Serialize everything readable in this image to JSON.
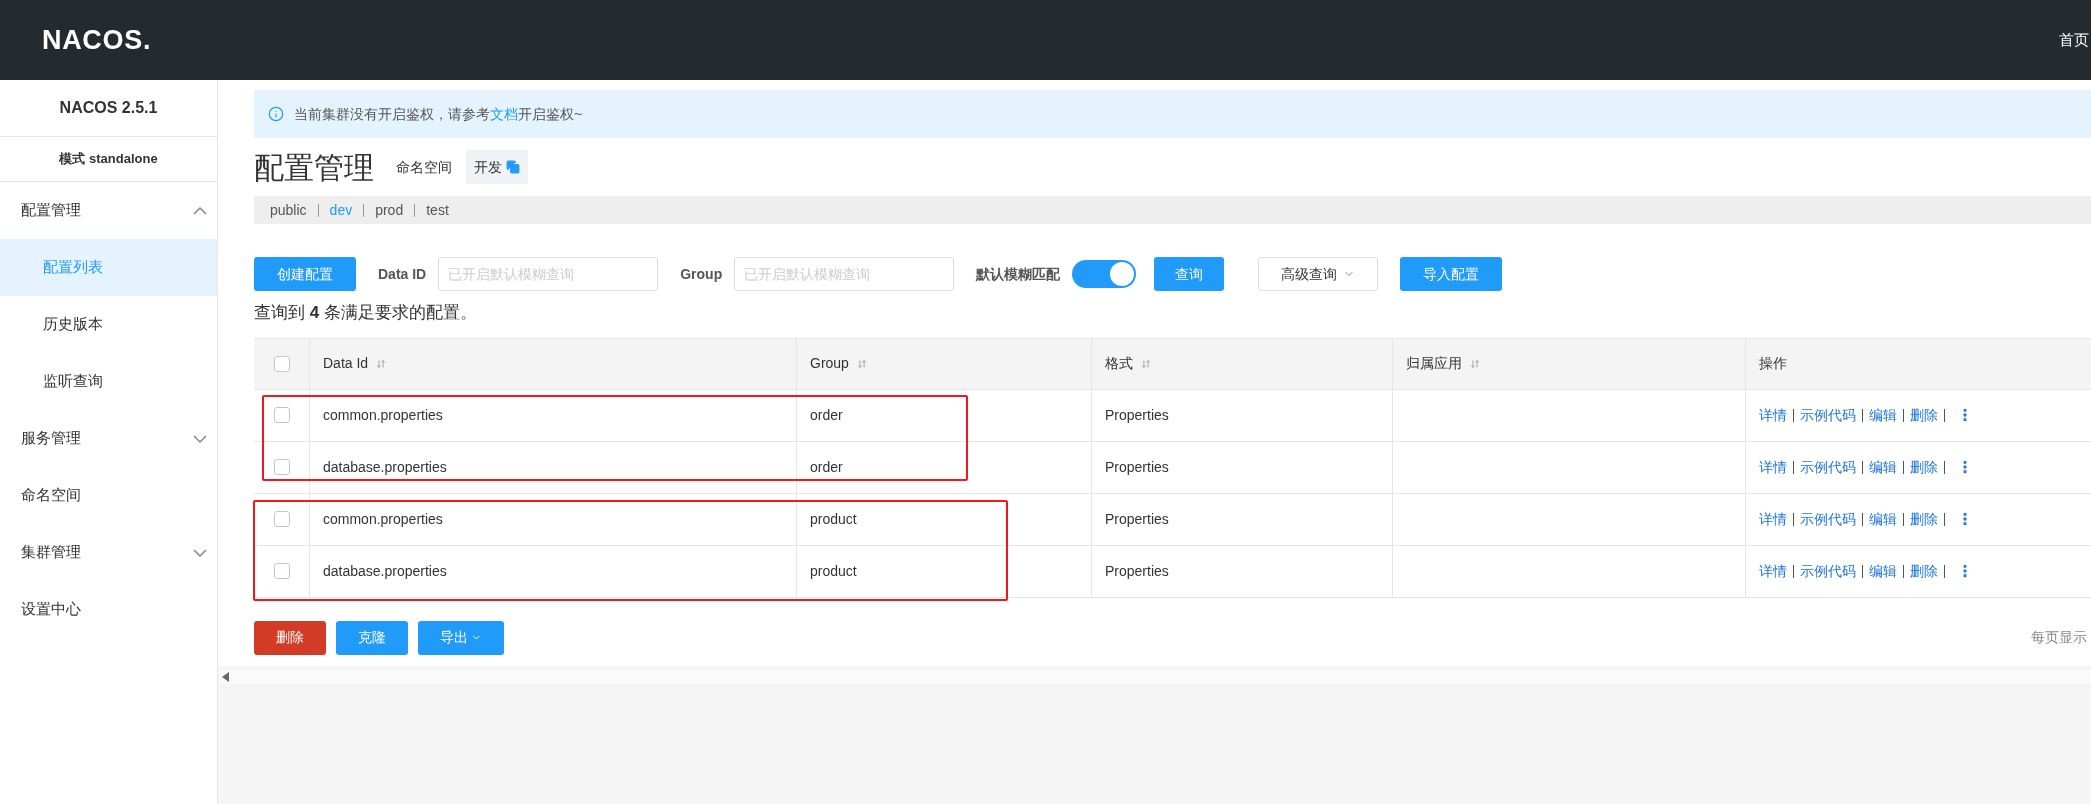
{
  "header": {
    "logo": "NACOS.",
    "nav": "首页"
  },
  "sidebar": {
    "title": "NACOS 2.5.1",
    "mode": "模式 standalone",
    "items": [
      {
        "label": "配置管理",
        "expanded": true,
        "selected": false,
        "children": [
          {
            "label": "配置列表",
            "selected": true
          },
          {
            "label": "历史版本",
            "selected": false
          },
          {
            "label": "监听查询",
            "selected": false
          }
        ]
      },
      {
        "label": "服务管理",
        "expanded": false,
        "selected": false
      },
      {
        "label": "命名空间",
        "selected": false
      },
      {
        "label": "集群管理",
        "expanded": false,
        "selected": false
      },
      {
        "label": "设置中心",
        "selected": false
      }
    ]
  },
  "notice": {
    "before": "当前集群没有开启鉴权，请参考",
    "link": "文档",
    "after": "开启鉴权~"
  },
  "page_title": "配置管理",
  "namespace_label": "命名空间",
  "namespace_value": "开发",
  "namespaces": [
    {
      "label": "public",
      "selected": false
    },
    {
      "label": "dev",
      "selected": true
    },
    {
      "label": "prod",
      "selected": false
    },
    {
      "label": "test",
      "selected": false
    }
  ],
  "toolbar": {
    "create": "创建配置",
    "data_id_label": "Data ID",
    "data_id_placeholder": "已开启默认模糊查询",
    "group_label": "Group",
    "group_placeholder": "已开启默认模糊查询",
    "fuzzy_label": "默认模糊匹配",
    "fuzzy_on": true,
    "query": "查询",
    "advanced": "高级查询",
    "import": "导入配置"
  },
  "summary": "查询到 **4** 条满足要求的配置。",
  "table": {
    "header_checked": false,
    "columns": [
      {
        "label": "Data Id",
        "sortable": true
      },
      {
        "label": "Group",
        "sortable": true
      },
      {
        "label": "格式",
        "sortable": true
      },
      {
        "label": "归属应用",
        "sortable": true
      },
      {
        "label": "操作",
        "sortable": false
      }
    ],
    "rows": [
      {
        "checked": false,
        "data_id": "common.properties",
        "group": "order",
        "format": "Properties",
        "app": "",
        "actions": [
          "详情",
          "示例代码",
          "编辑",
          "删除"
        ]
      },
      {
        "checked": false,
        "data_id": "database.properties",
        "group": "order",
        "format": "Properties",
        "app": "",
        "actions": [
          "详情",
          "示例代码",
          "编辑",
          "删除"
        ]
      },
      {
        "checked": false,
        "data_id": "common.properties",
        "group": "product",
        "format": "Properties",
        "app": "",
        "actions": [
          "详情",
          "示例代码",
          "编辑",
          "删除"
        ]
      },
      {
        "checked": false,
        "data_id": "database.properties",
        "group": "product",
        "format": "Properties",
        "app": "",
        "actions": [
          "详情",
          "示例代码",
          "编辑",
          "删除"
        ]
      }
    ]
  },
  "bottom": {
    "delete": "删除",
    "clone": "克隆",
    "export": "导出",
    "page_size_label": "每页显示"
  }
}
